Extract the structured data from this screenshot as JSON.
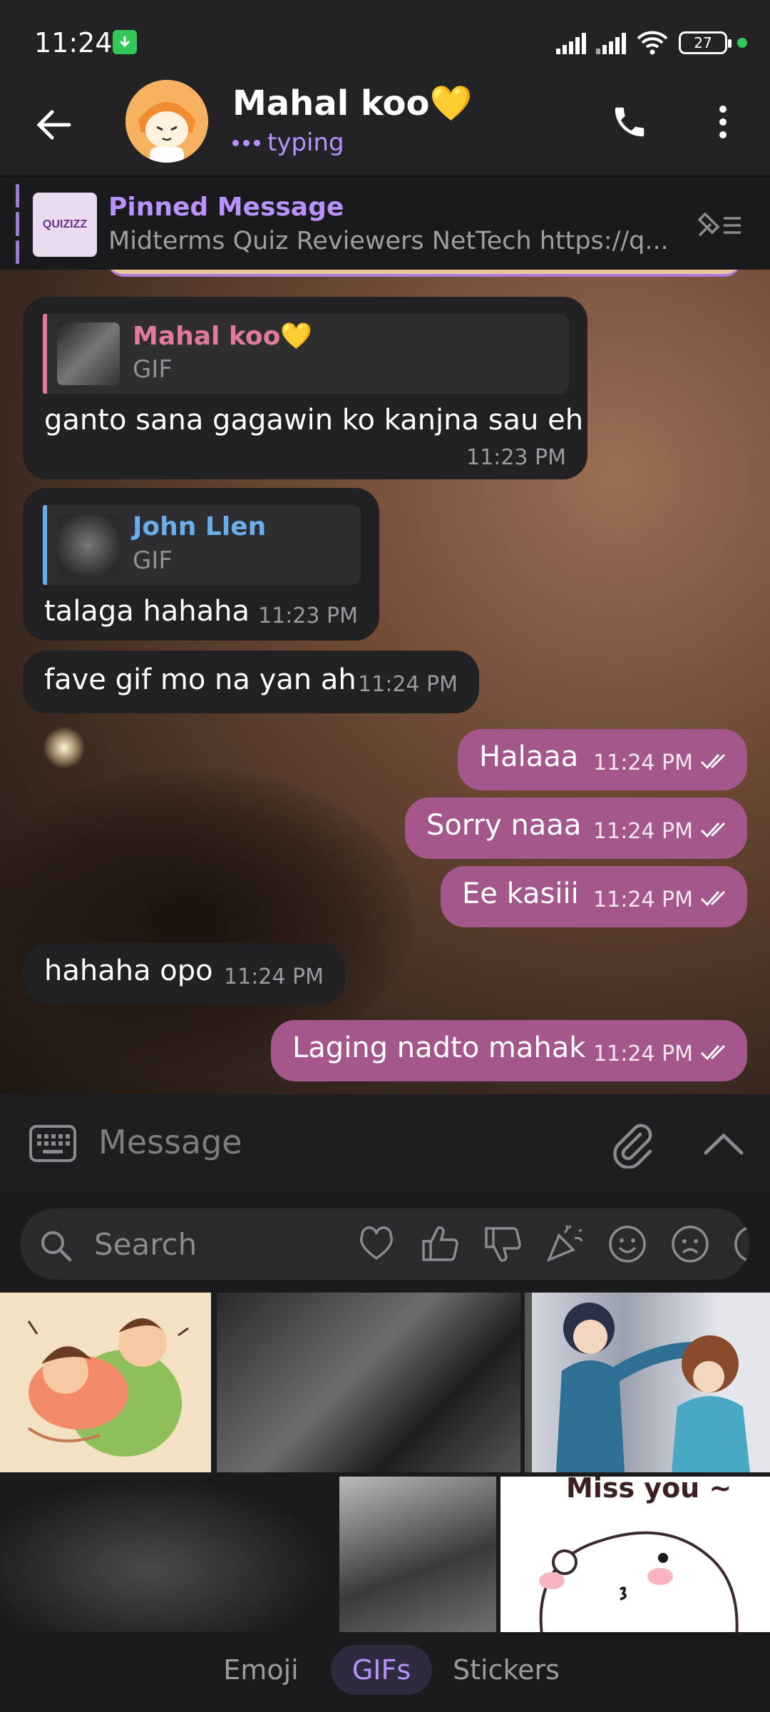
{
  "status_bar": {
    "time": "11:24",
    "battery": "27"
  },
  "header": {
    "name": "Mahal koo💛",
    "status": "typing"
  },
  "pinned": {
    "title": "Pinned Message",
    "thumb_label": "QUIZIZZ",
    "text": "Midterms Quiz Reviewers  NetTech https://q..."
  },
  "messages": [
    {
      "dir": "in",
      "reply_name": "Mahal koo💛",
      "reply_type": "GIF",
      "text": "ganto sana gagawin ko kanjna sau eh",
      "time": "11:23 PM"
    },
    {
      "dir": "in",
      "reply_name": "John Llen",
      "reply_type": "GIF",
      "text": "talaga hahaha",
      "time": "11:23 PM"
    },
    {
      "dir": "in",
      "text": "fave gif mo na yan ah",
      "time": "11:24 PM"
    },
    {
      "dir": "out",
      "text": "Halaaa",
      "time": "11:24 PM"
    },
    {
      "dir": "out",
      "text": "Sorry naaa",
      "time": "11:24 PM"
    },
    {
      "dir": "out",
      "text": "Ee kasiii",
      "time": "11:24 PM"
    },
    {
      "dir": "in",
      "text": "hahaha opo",
      "time": "11:24 PM"
    },
    {
      "dir": "out",
      "text": "Laging nadto mahak",
      "time": "11:24 PM"
    }
  ],
  "composer": {
    "placeholder": "Message"
  },
  "gif_panel": {
    "search_placeholder": "Search",
    "categories": [
      "heart-icon",
      "thumbs-up-icon",
      "thumbs-down-icon",
      "party-icon",
      "smile-icon",
      "sad-icon"
    ],
    "sticker_text": "Miss you ~",
    "tabs": [
      {
        "label": "Emoji",
        "active": false
      },
      {
        "label": "GIFs",
        "active": true
      },
      {
        "label": "Stickers",
        "active": false
      }
    ]
  },
  "colors": {
    "accent": "#b892ff",
    "outgoing_bubble": "#a4578a",
    "incoming_bubble": "#212124",
    "reply_pink": "#e27a9c",
    "reply_blue": "#6aaeee"
  }
}
